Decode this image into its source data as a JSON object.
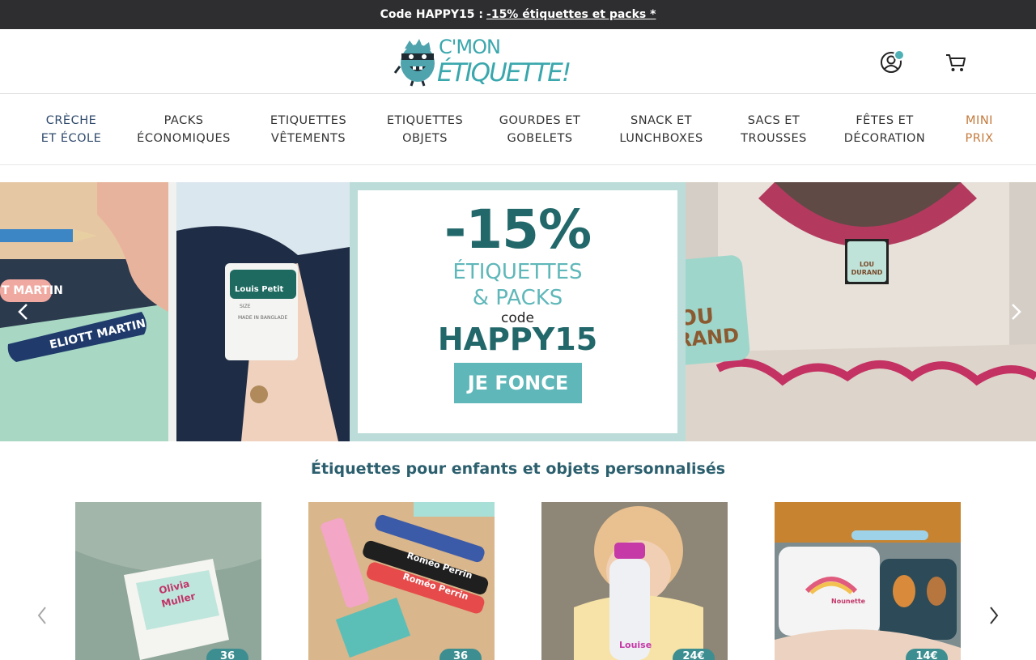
{
  "promo": {
    "code_text": "Code HAPPY15 :",
    "link_text": "-15% étiquettes et packs *"
  },
  "header": {
    "logo_line1": "C'MON",
    "logo_line2": "ÉTIQUETTE!"
  },
  "nav": [
    {
      "line1": "CRÈCHE",
      "line2": "ET ÉCOLE"
    },
    {
      "line1": "PACKS",
      "line2": "ÉCONOMIQUES"
    },
    {
      "line1": "ETIQUETTES",
      "line2": "VÊTEMENTS"
    },
    {
      "line1": "ETIQUETTES",
      "line2": "OBJETS"
    },
    {
      "line1": "GOURDES ET",
      "line2": "GOBELETS"
    },
    {
      "line1": "SNACK ET",
      "line2": "LUNCHBOXES"
    },
    {
      "line1": "SACS ET",
      "line2": "TROUSSES"
    },
    {
      "line1": "FÊTES ET",
      "line2": "DÉCORATION"
    },
    {
      "line1": "MINI",
      "line2": "PRIX"
    }
  ],
  "hero": {
    "label_1": "T MARTIN",
    "label_2": "ELIOTT MARTIN",
    "tag_name": "Louis Petit",
    "tag_size": "SIZE",
    "tag_origin": "MADE IN BANGLADE",
    "percent": "-15%",
    "line_1": "ÉTIQUETTES",
    "line_2": "& PACKS",
    "code_label": "code",
    "code_value": "HAPPY15",
    "cta": "JE FONCE",
    "sticker_line1": "LOU",
    "sticker_line2": "DURAND",
    "small_tag_line1": "LOU",
    "small_tag_line2": "DURAND"
  },
  "section": {
    "title": "Étiquettes pour enfants et objets personnalisés"
  },
  "cards": [
    {
      "badge": "36",
      "label_1": "Olivia",
      "label_2": "Muller"
    },
    {
      "badge": "36",
      "label_1": "Roméo Perrin",
      "label_2": "Roméo Perrin"
    },
    {
      "badge": "24€",
      "label_1": "Louise",
      "label_2": ""
    },
    {
      "badge": "14€",
      "label_1": "Nounette",
      "label_2": ""
    }
  ],
  "colors": {
    "promo_bg": "#2e2e30",
    "brand_teal": "#3aa7ad",
    "dark_teal": "#22686a",
    "nav_highlight": "#c47a3c",
    "nav_first": "#2f4a6d"
  },
  "icons": {
    "account": "user-circle-icon",
    "cart": "shopping-cart-icon",
    "prev": "chevron-left-icon",
    "next": "chevron-right-icon"
  }
}
